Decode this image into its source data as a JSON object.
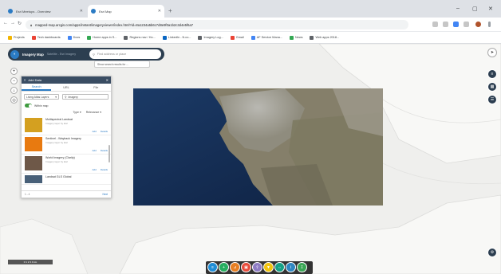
{
  "browser": {
    "tabs": [
      {
        "title": "Esri Meetups - Overview",
        "favicon_color": "#2b7bc4"
      },
      {
        "title": "Esri Map",
        "favicon_color": "#2b7bc4"
      }
    ],
    "url": "mapped-map.arcgis.com/apps/instant/imageryviewer/index.html?id=8a1234a5b6c7d8e9f0a1b2c3d4e5f6a7",
    "bookmarks": [
      {
        "label": "Projects",
        "color": "#f2b400"
      },
      {
        "label": "Tech dashboards",
        "color": "#ea4335"
      },
      {
        "label": "Docs",
        "color": "#4285f4"
      },
      {
        "label": "Home apps in S...",
        "color": "#34a853"
      },
      {
        "label": "Regions nav / Ho...",
        "color": "#5f6368"
      },
      {
        "label": "LinkedIn - N.co...",
        "color": "#0a66c2"
      },
      {
        "label": "Imagery Log...",
        "color": "#5f6368"
      },
      {
        "label": "Gmail",
        "color": "#ea4335"
      },
      {
        "label": "AF Service Mana...",
        "color": "#4285f4"
      },
      {
        "label": "News",
        "color": "#34a853"
      },
      {
        "label": "Web apps 2018...",
        "color": "#5f6368"
      }
    ]
  },
  "app": {
    "title": "Imagery Map",
    "subtitle": "Satellite - Esri Imagery",
    "search_placeholder": "Find address or place",
    "tooltip": "Show search results for ..."
  },
  "panel": {
    "title": "Add Data",
    "tabs": [
      "Search",
      "URL",
      "File"
    ],
    "scope": "Living Atlas Layers",
    "filter_value": "Imagery",
    "toggle_label": "Within map",
    "filter_type": "Type",
    "sort_label": "Relevance",
    "items": [
      {
        "title": "Multispectral Landsat",
        "sub": "Imagery layer by Esri",
        "thumb": "#d4a020",
        "actions": [
          "Add",
          "Details"
        ]
      },
      {
        "title": "Sentinel - Wayback Imagery",
        "sub": "Imagery layer by Esri",
        "thumb": "#e87a10",
        "actions": [
          "Add",
          "Details"
        ]
      },
      {
        "title": "World Imagery (Clarity)",
        "sub": "Imagery layer by Esri",
        "thumb": "#6e5848",
        "actions": [
          "Add",
          "Details"
        ]
      },
      {
        "title": "Landsat GLS Global",
        "sub": "Imagery layer by Esri",
        "thumb": "#486078",
        "actions": [
          "Add",
          "Details"
        ]
      }
    ],
    "footer_count": "1 - 4",
    "footer_paging": "Next"
  },
  "icons": {
    "zoom_in": "plus-icon",
    "zoom_out": "minus-icon",
    "home": "home-icon",
    "locate": "locate-icon",
    "compass": "compass-icon",
    "layers": "layers-icon",
    "basemap": "basemap-icon",
    "legend": "legend-icon",
    "settings": "gear-icon"
  },
  "scalebar_label": "0 1 2 3 4 km",
  "dock_buttons": [
    {
      "name": "dock-layers-button",
      "color": "#1f8dd6"
    },
    {
      "name": "dock-add-button",
      "color": "#27ae60"
    },
    {
      "name": "dock-measure-button",
      "color": "#e67e22"
    },
    {
      "name": "dock-print-button",
      "color": "#e74c3c"
    },
    {
      "name": "dock-share-button",
      "color": "#8e7cc3"
    },
    {
      "name": "dock-filter-button",
      "color": "#f1c40f"
    },
    {
      "name": "dock-swipe-button",
      "color": "#16a085"
    },
    {
      "name": "dock-info-button",
      "color": "#2e86c1"
    },
    {
      "name": "dock-export-button",
      "color": "#3aa655"
    }
  ],
  "colors": {
    "header": "#2c3e50",
    "accent": "#2b7bc4",
    "sea_image": "#142a4a",
    "land_image": "#8a8777"
  }
}
